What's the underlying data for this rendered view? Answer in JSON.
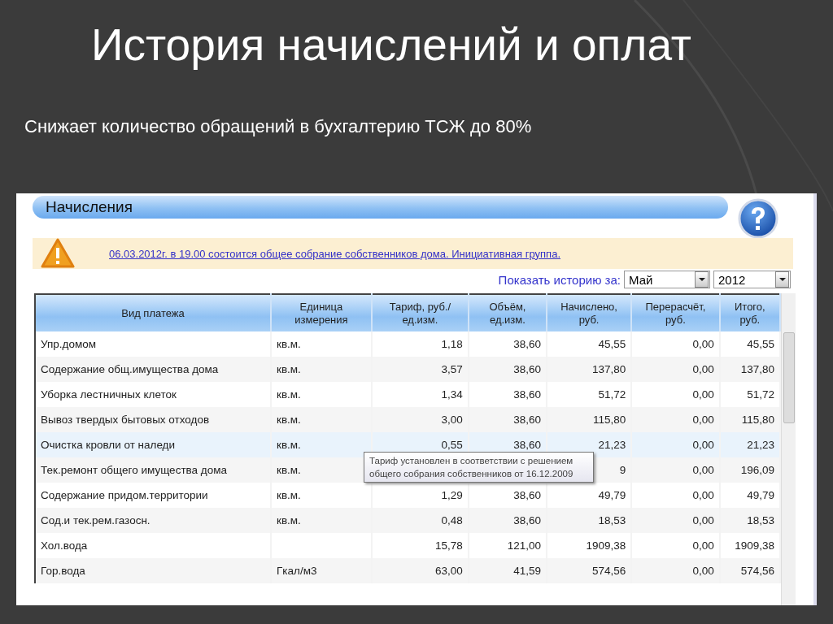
{
  "slide": {
    "title": "История начислений и оплат",
    "subtitle": "Снижает количество обращений в бухгалтерию ТСЖ до 80%"
  },
  "panel": {
    "title": "Начисления",
    "notice": "06.03.2012г. в 19.00 состоится общее собрание собственников дома. Инициативная группа.",
    "filter": {
      "label": "Показать историю за:",
      "month": "Май",
      "year": "2012"
    },
    "table": {
      "columns": [
        "Вид платежа",
        "Единица измерения",
        "Тариф, руб./ед.изм.",
        "Объём, ед.изм.",
        "Начислено, руб.",
        "Перерасчёт, руб.",
        "Итого, руб."
      ],
      "rows": [
        {
          "highlighted": false,
          "cells": [
            "Упр.домом",
            "кв.м.",
            "1,18",
            "38,60",
            "45,55",
            "0,00",
            "45,55"
          ]
        },
        {
          "highlighted": false,
          "cells": [
            "Содержание общ.имущества дома",
            "кв.м.",
            "3,57",
            "38,60",
            "137,80",
            "0,00",
            "137,80"
          ]
        },
        {
          "highlighted": false,
          "cells": [
            "Уборка лестничных клеток",
            "кв.м.",
            "1,34",
            "38,60",
            "51,72",
            "0,00",
            "51,72"
          ]
        },
        {
          "highlighted": false,
          "cells": [
            "Вывоз твердых бытовых отходов",
            "кв.м.",
            "3,00",
            "38,60",
            "115,80",
            "0,00",
            "115,80"
          ]
        },
        {
          "highlighted": true,
          "cells": [
            "Очистка кровли от наледи",
            "кв.м.",
            "0,55",
            "38,60",
            "21,23",
            "0,00",
            "21,23"
          ]
        },
        {
          "highlighted": false,
          "cells": [
            "Тек.ремонт общего имущества дома",
            "кв.м.",
            null,
            null,
            "9",
            "0,00",
            "196,09"
          ]
        },
        {
          "highlighted": false,
          "cells": [
            "Содержание придом.территории",
            "кв.м.",
            "1,29",
            "38,60",
            "49,79",
            "0,00",
            "49,79"
          ]
        },
        {
          "highlighted": false,
          "cells": [
            "Сод.и тек.рем.газосн.",
            "кв.м.",
            "0,48",
            "38,60",
            "18,53",
            "0,00",
            "18,53"
          ]
        },
        {
          "highlighted": false,
          "cells": [
            "Хол.вода",
            null,
            "15,78",
            "121,00",
            "1909,38",
            "0,00",
            "1909,38"
          ]
        },
        {
          "highlighted": false,
          "cells": [
            "Гор.вода",
            "Гкал/м3",
            "63,00",
            "41,59",
            "574,56",
            "0,00",
            "574,56"
          ]
        }
      ],
      "tooltip": "Тариф установлен в соответствии с решением общего собрания собственников от 16.12.2009"
    }
  }
}
